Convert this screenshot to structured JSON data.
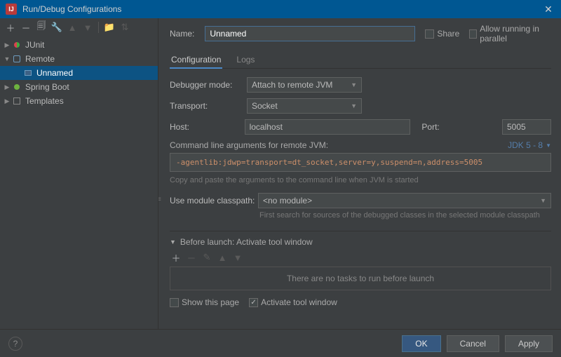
{
  "title": "Run/Debug Configurations",
  "sidebar": {
    "items": [
      {
        "label": "JUnit",
        "icon": "junit",
        "expanded": false,
        "depth": 0
      },
      {
        "label": "Remote",
        "icon": "remote",
        "expanded": true,
        "depth": 0
      },
      {
        "label": "Unnamed",
        "icon": "remote-leaf",
        "selected": true,
        "depth": 1
      },
      {
        "label": "Spring Boot",
        "icon": "spring",
        "expanded": false,
        "depth": 0
      },
      {
        "label": "Templates",
        "icon": "tpl",
        "expanded": false,
        "depth": 0
      }
    ]
  },
  "form": {
    "name_label": "Name:",
    "name_value": "Unnamed",
    "share_label": "Share",
    "parallel_label": "Allow running in parallel",
    "tabs": {
      "config": "Configuration",
      "logs": "Logs"
    },
    "debugger_mode_label": "Debugger mode:",
    "debugger_mode_value": "Attach to remote JVM",
    "transport_label": "Transport:",
    "transport_value": "Socket",
    "host_label": "Host:",
    "host_value": "localhost",
    "port_label": "Port:",
    "port_value": "5005",
    "cmd_label": "Command line arguments for remote JVM:",
    "jdk_link": "JDK 5 - 8",
    "cmd_value": "-agentlib:jdwp=transport=dt_socket,server=y,suspend=n,address=5005",
    "cmd_hint": "Copy and paste the arguments to the command line when JVM is started",
    "module_label": "Use module classpath:",
    "module_value": "<no module>",
    "module_hint": "First search for sources of the debugged classes in the selected module classpath",
    "before_label": "Before launch: Activate tool window",
    "tasks_empty": "There are no tasks to run before launch",
    "show_page_label": "Show this page",
    "activate_label": "Activate tool window"
  },
  "footer": {
    "ok": "OK",
    "cancel": "Cancel",
    "apply": "Apply"
  }
}
